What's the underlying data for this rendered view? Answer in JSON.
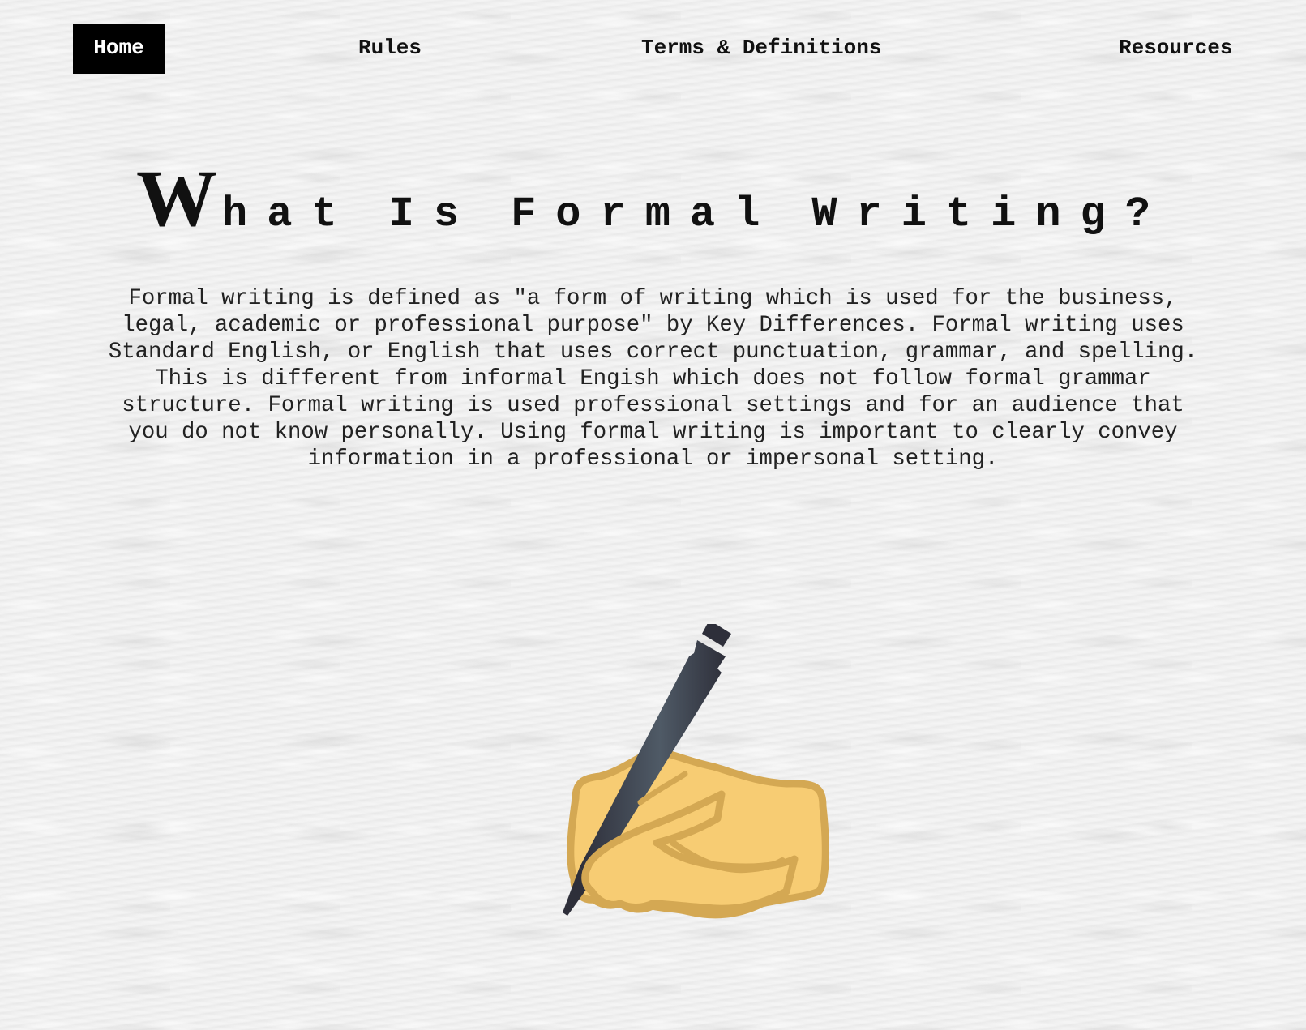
{
  "nav": {
    "items": [
      {
        "label": "Home",
        "active": true
      },
      {
        "label": "Rules",
        "active": false
      },
      {
        "label": "Terms & Definitions",
        "active": false
      },
      {
        "label": "Resources",
        "active": false
      }
    ]
  },
  "hero": {
    "title_initial": "W",
    "title_word1_rest": "hat",
    "title_word2": "Is",
    "title_word3": "Formal",
    "title_word4": "Writing?",
    "paragraph": "Formal writing is defined as \"a form of writing which is used for the business, legal, academic or professional purpose\" by Key Differences. Formal writing uses Standard English, or English that uses correct punctuation, grammar, and spelling. This is different from informal Engish which does not follow formal grammar structure. Formal writing is used professional settings and for an audience that you do not know personally. Using formal writing is important to clearly convey information in a professional or impersonal setting."
  },
  "illustration": {
    "icon": "writing-hand-icon",
    "colors": {
      "skin": "#f7cc73",
      "skin_outline": "#d4a853",
      "pen": "#2e2f3a",
      "pen_highlight": "#4f5a66"
    }
  }
}
